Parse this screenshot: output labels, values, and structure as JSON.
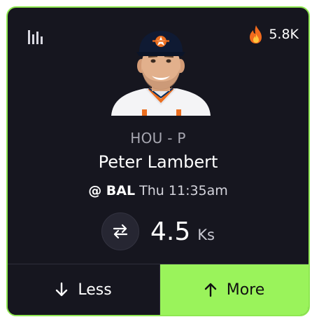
{
  "card": {
    "trend": {
      "icon": "fire-icon",
      "count": "5.8K"
    },
    "stats_icon": "bar-chart-icon",
    "player": {
      "team_position": "HOU - P",
      "name": "Peter Lambert",
      "opponent": "@ BAL",
      "game_time": "Thu 11:35am"
    },
    "line": {
      "value": "4.5",
      "unit": "Ks",
      "swap_icon": "swap-icon"
    },
    "actions": {
      "less_label": "Less",
      "less_icon": "arrow-down-icon",
      "more_label": "More",
      "more_icon": "arrow-up-icon"
    },
    "colors": {
      "accent": "#9af35b",
      "border": "#8fe852",
      "background": "#16161f"
    }
  }
}
